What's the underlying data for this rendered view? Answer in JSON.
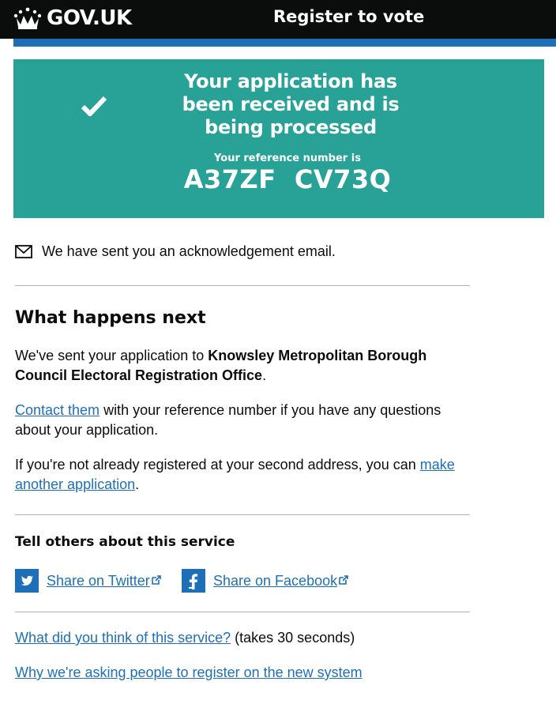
{
  "header": {
    "logo_text": "GOV.UK",
    "service_name": "Register to vote"
  },
  "confirmation": {
    "title": "Your application has been received and is being processed",
    "reference_label": "Your reference number is",
    "reference_number": "A37ZF  CV73Q"
  },
  "email_notice": {
    "icon": "mail-icon",
    "text": "We have sent you an acknowledgement email."
  },
  "next_steps": {
    "heading": "What happens next",
    "sent_prefix": "We've sent your application to ",
    "office_name": "Knowsley Metropolitan Borough Council Electoral Registration Office",
    "sent_suffix": ".",
    "contact_link": "Contact them",
    "contact_rest": " with your reference number if you have any questions about your application.",
    "second_address_prefix": "If you're not already registered at your second address, you can ",
    "second_address_link": "make another application",
    "second_address_suffix": "."
  },
  "share": {
    "heading": "Tell others about this service",
    "twitter_label": "Share on Twitter",
    "facebook_label": "Share on Facebook"
  },
  "feedback": {
    "link": "What did you think of this service?",
    "note": " (takes 30 seconds)"
  },
  "why_link": "Why we're asking people to register on the new system",
  "colors": {
    "header_bg": "#0b0c0c",
    "header_bar": "#1d70b8",
    "panel_bg": "#28a197",
    "link": "#1d70b8",
    "twitter": "#1d70b8",
    "facebook": "#1d70b8",
    "rule": "#b1b4b6"
  }
}
